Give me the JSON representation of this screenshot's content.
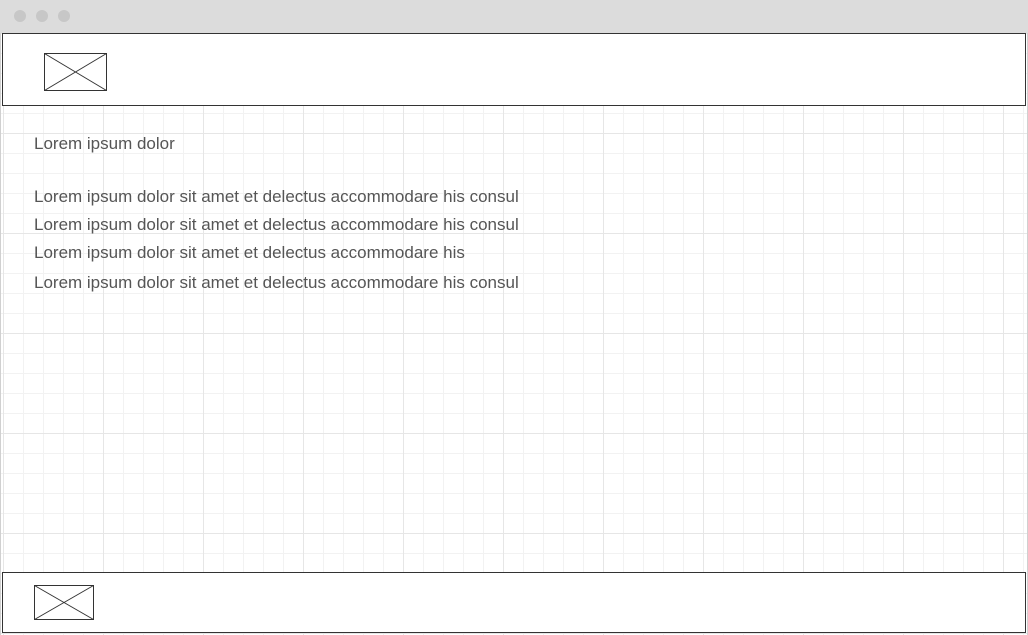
{
  "header": {
    "logo_icon": "image-placeholder-icon"
  },
  "content": {
    "heading": "Lorem ipsum dolor",
    "lines": [
      "Lorem ipsum dolor sit amet et delectus accommodare his consul",
      "Lorem ipsum dolor sit amet et delectus accommodare his consul",
      "Lorem ipsum dolor sit amet et delectus accommodare his",
      "Lorem ipsum dolor sit amet et delectus accommodare his consul"
    ]
  },
  "footer": {
    "logo_icon": "image-placeholder-icon"
  },
  "colors": {
    "text": "#555555",
    "border": "#333333",
    "titlebar": "#dcdcdc",
    "grid": "#e6e6e6"
  }
}
